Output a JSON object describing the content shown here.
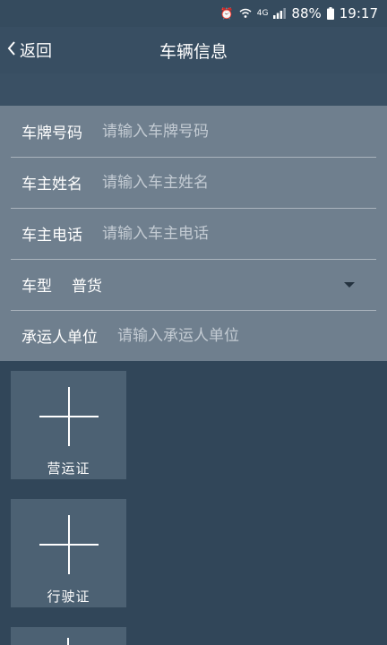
{
  "status_bar": {
    "alarm_icon": "alarm-clock-icon",
    "wifi_icon": "wifi-icon",
    "network": "4G",
    "battery": "88%",
    "time": "19:17"
  },
  "navbar": {
    "back_label": "返回",
    "title": "车辆信息"
  },
  "form": {
    "plate": {
      "label": "车牌号码",
      "placeholder": "请输入车牌号码"
    },
    "owner_name": {
      "label": "车主姓名",
      "placeholder": "请输入车主姓名"
    },
    "owner_phone": {
      "label": "车主电话",
      "placeholder": "请输入车主电话"
    },
    "vehicle_type": {
      "label": "车型",
      "value": "普货"
    },
    "carrier": {
      "label": "承运人单位",
      "placeholder": "请输入承运人单位"
    }
  },
  "uploads": {
    "license1": "营运证",
    "license2": "行驶证"
  },
  "colors": {
    "background": "#314659",
    "form_background": "#6f7f8e",
    "upload_tile": "#4c6173"
  }
}
